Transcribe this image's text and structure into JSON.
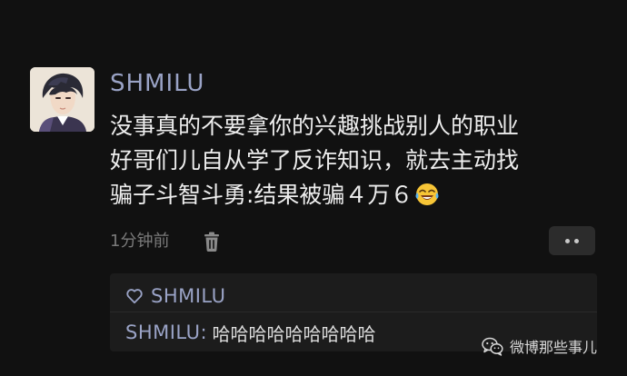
{
  "post": {
    "username": "SHMILU",
    "text_lines": [
      "没事真的不要拿你的兴趣挑战别人的职业",
      "好哥们儿自从学了反诈知识，就去主动找",
      "骗子斗智斗勇:结果被骗４万６"
    ],
    "emoji": "crying-laughing-emoji",
    "time": "1分钟前"
  },
  "likes": {
    "names": "SHMILU"
  },
  "comment": {
    "author": "SHMILU",
    "separator": ":",
    "text": "哈哈哈哈哈哈哈哈哈"
  },
  "watermark": {
    "text": "微博那些事儿"
  },
  "colors": {
    "background": "#111111",
    "username": "#9aa3c6",
    "body_text": "#eeeeee",
    "muted": "#7a7a7a",
    "panel": "#1c1c1c"
  }
}
